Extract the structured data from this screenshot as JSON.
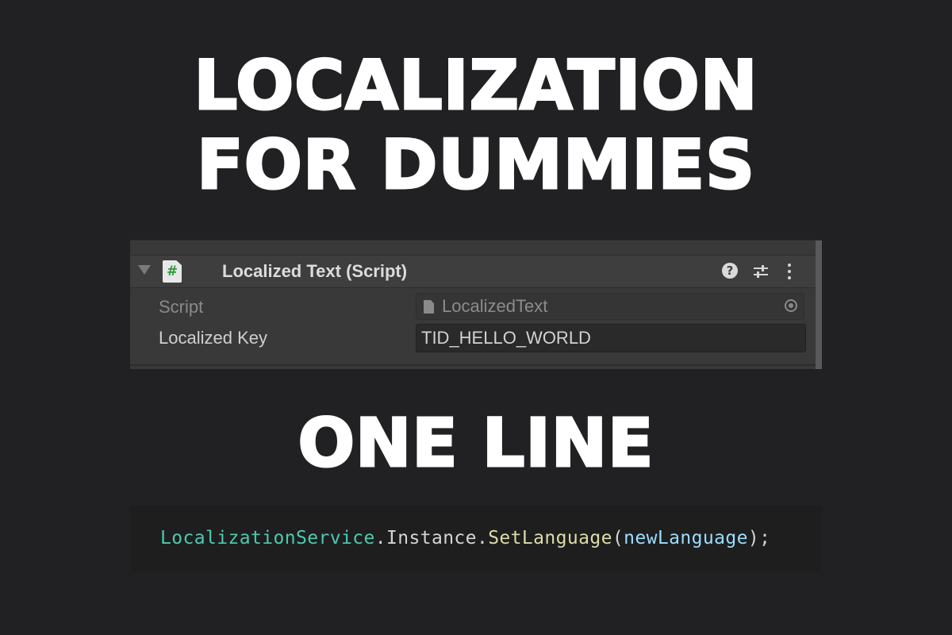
{
  "headline": {
    "line1": "LOCALIZATION",
    "line2": "FOR DUMMIES",
    "line3": "ONE LINE"
  },
  "inspector": {
    "component_title": "Localized Text (Script)",
    "component_icon_glyph": "#",
    "icons": [
      "foldout-arrow-icon",
      "csharp-script-icon",
      "help-icon",
      "presets-icon",
      "context-menu-icon"
    ],
    "properties": [
      {
        "label": "Script",
        "value": "LocalizedText",
        "type": "object-field",
        "disabled": true
      },
      {
        "label": "Localized Key",
        "value": "TID_HELLO_WORLD",
        "type": "text-field",
        "disabled": false
      }
    ]
  },
  "code": {
    "class_name": "LocalizationService",
    "dot1": ".",
    "property": "Instance",
    "dot2": ".",
    "method": "SetLanguage",
    "open_paren": "(",
    "argument": "newLanguage",
    "close": ");"
  },
  "colors": {
    "background": "#212023",
    "headline": "#ffffff",
    "code_class": "#4ec9b0",
    "code_punct": "#d4d4d4",
    "code_member": "#d4d4d4",
    "code_method": "#dcdcaa",
    "code_arg": "#9cdcfe"
  }
}
